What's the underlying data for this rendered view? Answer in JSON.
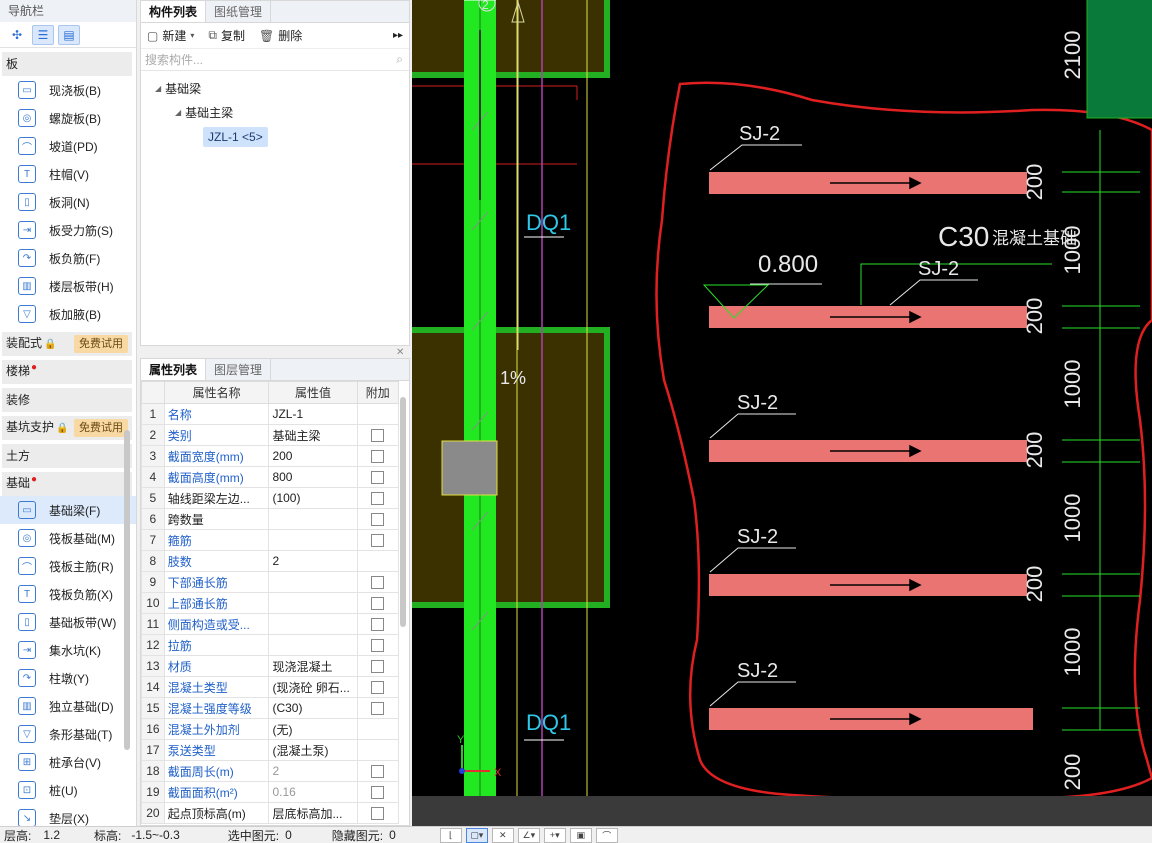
{
  "nav": {
    "title": "导航栏",
    "categories": {
      "ban": "板",
      "zhuangpeishi": "装配式",
      "louti": "楼梯",
      "zhuangxiu": "装修",
      "jikeng": "基坑支护",
      "tufang": "土方",
      "jichu": "基础"
    },
    "free_trial": "免费试用",
    "ban_items": [
      "现浇板(B)",
      "螺旋板(B)",
      "坡道(PD)",
      "柱帽(V)",
      "板洞(N)",
      "板受力筋(S)",
      "板负筋(F)",
      "楼层板带(H)",
      "板加腋(B)"
    ],
    "jichu_items": [
      "基础梁(F)",
      "筏板基础(M)",
      "筏板主筋(R)",
      "筏板负筋(X)",
      "基础板带(W)",
      "集水坑(K)",
      "柱墩(Y)",
      "独立基础(D)",
      "条形基础(T)",
      "桩承台(V)",
      "桩(U)",
      "垫层(X)"
    ]
  },
  "component_panel": {
    "tabs": [
      "构件列表",
      "图纸管理"
    ],
    "tools": {
      "new": "新建",
      "copy": "复制",
      "delete": "删除"
    },
    "search_placeholder": "搜索构件...",
    "tree": {
      "root": "基础梁",
      "child": "基础主梁",
      "leaf": "JZL-1 <5>"
    }
  },
  "property_panel": {
    "tabs": [
      "属性列表",
      "图层管理"
    ],
    "headers": {
      "name": "属性名称",
      "value": "属性值",
      "extra": "附加"
    },
    "rows": [
      {
        "n": "1",
        "name": "名称",
        "value": "JZL-1",
        "blue": true,
        "cb": false
      },
      {
        "n": "2",
        "name": "类别",
        "value": "基础主梁",
        "blue": true,
        "cb": true
      },
      {
        "n": "3",
        "name": "截面宽度(mm)",
        "value": "200",
        "blue": true,
        "cb": true
      },
      {
        "n": "4",
        "name": "截面高度(mm)",
        "value": "800",
        "blue": true,
        "cb": true
      },
      {
        "n": "5",
        "name": "轴线距梁左边...",
        "value": "(100)",
        "blue": false,
        "cb": true
      },
      {
        "n": "6",
        "name": "跨数量",
        "value": "",
        "blue": false,
        "cb": true
      },
      {
        "n": "7",
        "name": "箍筋",
        "value": "",
        "blue": true,
        "cb": true
      },
      {
        "n": "8",
        "name": "肢数",
        "value": "2",
        "blue": true,
        "cb": false
      },
      {
        "n": "9",
        "name": "下部通长筋",
        "value": "",
        "blue": true,
        "cb": true
      },
      {
        "n": "10",
        "name": "上部通长筋",
        "value": "",
        "blue": true,
        "cb": true
      },
      {
        "n": "11",
        "name": "侧面构造或受...",
        "value": "",
        "blue": true,
        "cb": true
      },
      {
        "n": "12",
        "name": "拉筋",
        "value": "",
        "blue": true,
        "cb": true
      },
      {
        "n": "13",
        "name": "材质",
        "value": "现浇混凝土",
        "blue": true,
        "cb": true
      },
      {
        "n": "14",
        "name": "混凝土类型",
        "value": "(现浇砼 卵石...",
        "blue": true,
        "cb": true
      },
      {
        "n": "15",
        "name": "混凝土强度等级",
        "value": "(C30)",
        "blue": true,
        "cb": true
      },
      {
        "n": "16",
        "name": "混凝土外加剂",
        "value": "(无)",
        "blue": true,
        "cb": false
      },
      {
        "n": "17",
        "name": "泵送类型",
        "value": "(混凝土泵)",
        "blue": true,
        "cb": false
      },
      {
        "n": "18",
        "name": "截面周长(m)",
        "value": "2",
        "blue": true,
        "cb": true,
        "gray": true
      },
      {
        "n": "19",
        "name": "截面面积(m²)",
        "value": "0.16",
        "blue": true,
        "cb": true,
        "gray": true
      },
      {
        "n": "20",
        "name": "起点顶标高(m)",
        "value": "层底标高加...",
        "blue": false,
        "cb": true
      }
    ]
  },
  "canvas": {
    "labels": {
      "sj": "SJ-2",
      "dq": "DQ1",
      "elev": "0.800",
      "concrete": "C30",
      "concrete_sub": "混凝土基础",
      "slope": "1%",
      "dim_2100": "2100",
      "dim_200": "200",
      "dim_1000": "1000",
      "axis": "2",
      "x": "X",
      "y": "Y"
    },
    "colors": {
      "bg": "#000000",
      "green": "#28e028",
      "bar": "#ea7472",
      "cloud": "#e02020"
    }
  },
  "status": {
    "floor_label": "层高:",
    "floor_value": "1.2",
    "elev_label": "标高:",
    "elev_value": "-1.5~-0.3",
    "sel_label": "选中图元:",
    "sel_value": "0",
    "hidden_label": "隐藏图元:",
    "hidden_value": "0"
  }
}
